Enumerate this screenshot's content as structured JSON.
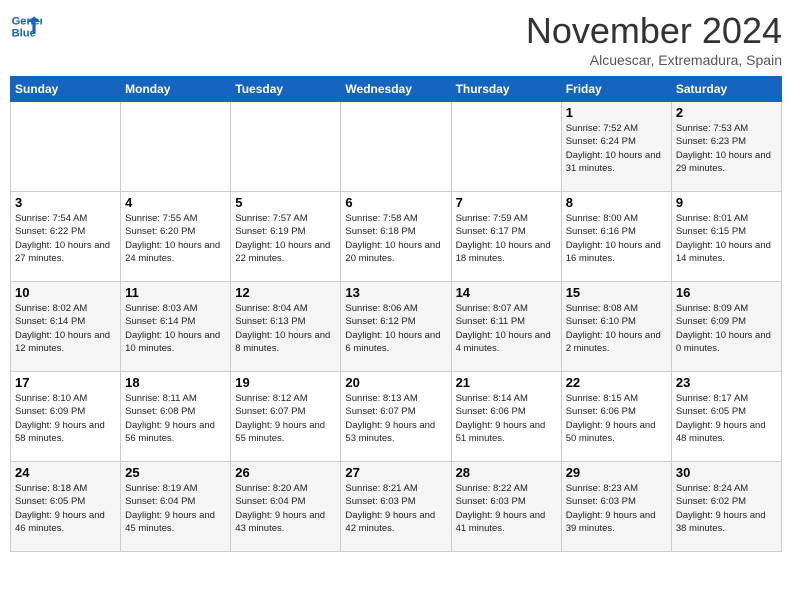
{
  "header": {
    "logo_line1": "General",
    "logo_line2": "Blue",
    "month_title": "November 2024",
    "location": "Alcuescar, Extremadura, Spain"
  },
  "days_of_week": [
    "Sunday",
    "Monday",
    "Tuesday",
    "Wednesday",
    "Thursday",
    "Friday",
    "Saturday"
  ],
  "weeks": [
    [
      {
        "day": "",
        "details": ""
      },
      {
        "day": "",
        "details": ""
      },
      {
        "day": "",
        "details": ""
      },
      {
        "day": "",
        "details": ""
      },
      {
        "day": "",
        "details": ""
      },
      {
        "day": "1",
        "details": "Sunrise: 7:52 AM\nSunset: 6:24 PM\nDaylight: 10 hours and 31 minutes."
      },
      {
        "day": "2",
        "details": "Sunrise: 7:53 AM\nSunset: 6:23 PM\nDaylight: 10 hours and 29 minutes."
      }
    ],
    [
      {
        "day": "3",
        "details": "Sunrise: 7:54 AM\nSunset: 6:22 PM\nDaylight: 10 hours and 27 minutes."
      },
      {
        "day": "4",
        "details": "Sunrise: 7:55 AM\nSunset: 6:20 PM\nDaylight: 10 hours and 24 minutes."
      },
      {
        "day": "5",
        "details": "Sunrise: 7:57 AM\nSunset: 6:19 PM\nDaylight: 10 hours and 22 minutes."
      },
      {
        "day": "6",
        "details": "Sunrise: 7:58 AM\nSunset: 6:18 PM\nDaylight: 10 hours and 20 minutes."
      },
      {
        "day": "7",
        "details": "Sunrise: 7:59 AM\nSunset: 6:17 PM\nDaylight: 10 hours and 18 minutes."
      },
      {
        "day": "8",
        "details": "Sunrise: 8:00 AM\nSunset: 6:16 PM\nDaylight: 10 hours and 16 minutes."
      },
      {
        "day": "9",
        "details": "Sunrise: 8:01 AM\nSunset: 6:15 PM\nDaylight: 10 hours and 14 minutes."
      }
    ],
    [
      {
        "day": "10",
        "details": "Sunrise: 8:02 AM\nSunset: 6:14 PM\nDaylight: 10 hours and 12 minutes."
      },
      {
        "day": "11",
        "details": "Sunrise: 8:03 AM\nSunset: 6:14 PM\nDaylight: 10 hours and 10 minutes."
      },
      {
        "day": "12",
        "details": "Sunrise: 8:04 AM\nSunset: 6:13 PM\nDaylight: 10 hours and 8 minutes."
      },
      {
        "day": "13",
        "details": "Sunrise: 8:06 AM\nSunset: 6:12 PM\nDaylight: 10 hours and 6 minutes."
      },
      {
        "day": "14",
        "details": "Sunrise: 8:07 AM\nSunset: 6:11 PM\nDaylight: 10 hours and 4 minutes."
      },
      {
        "day": "15",
        "details": "Sunrise: 8:08 AM\nSunset: 6:10 PM\nDaylight: 10 hours and 2 minutes."
      },
      {
        "day": "16",
        "details": "Sunrise: 8:09 AM\nSunset: 6:09 PM\nDaylight: 10 hours and 0 minutes."
      }
    ],
    [
      {
        "day": "17",
        "details": "Sunrise: 8:10 AM\nSunset: 6:09 PM\nDaylight: 9 hours and 58 minutes."
      },
      {
        "day": "18",
        "details": "Sunrise: 8:11 AM\nSunset: 6:08 PM\nDaylight: 9 hours and 56 minutes."
      },
      {
        "day": "19",
        "details": "Sunrise: 8:12 AM\nSunset: 6:07 PM\nDaylight: 9 hours and 55 minutes."
      },
      {
        "day": "20",
        "details": "Sunrise: 8:13 AM\nSunset: 6:07 PM\nDaylight: 9 hours and 53 minutes."
      },
      {
        "day": "21",
        "details": "Sunrise: 8:14 AM\nSunset: 6:06 PM\nDaylight: 9 hours and 51 minutes."
      },
      {
        "day": "22",
        "details": "Sunrise: 8:15 AM\nSunset: 6:06 PM\nDaylight: 9 hours and 50 minutes."
      },
      {
        "day": "23",
        "details": "Sunrise: 8:17 AM\nSunset: 6:05 PM\nDaylight: 9 hours and 48 minutes."
      }
    ],
    [
      {
        "day": "24",
        "details": "Sunrise: 8:18 AM\nSunset: 6:05 PM\nDaylight: 9 hours and 46 minutes."
      },
      {
        "day": "25",
        "details": "Sunrise: 8:19 AM\nSunset: 6:04 PM\nDaylight: 9 hours and 45 minutes."
      },
      {
        "day": "26",
        "details": "Sunrise: 8:20 AM\nSunset: 6:04 PM\nDaylight: 9 hours and 43 minutes."
      },
      {
        "day": "27",
        "details": "Sunrise: 8:21 AM\nSunset: 6:03 PM\nDaylight: 9 hours and 42 minutes."
      },
      {
        "day": "28",
        "details": "Sunrise: 8:22 AM\nSunset: 6:03 PM\nDaylight: 9 hours and 41 minutes."
      },
      {
        "day": "29",
        "details": "Sunrise: 8:23 AM\nSunset: 6:03 PM\nDaylight: 9 hours and 39 minutes."
      },
      {
        "day": "30",
        "details": "Sunrise: 8:24 AM\nSunset: 6:02 PM\nDaylight: 9 hours and 38 minutes."
      }
    ]
  ]
}
